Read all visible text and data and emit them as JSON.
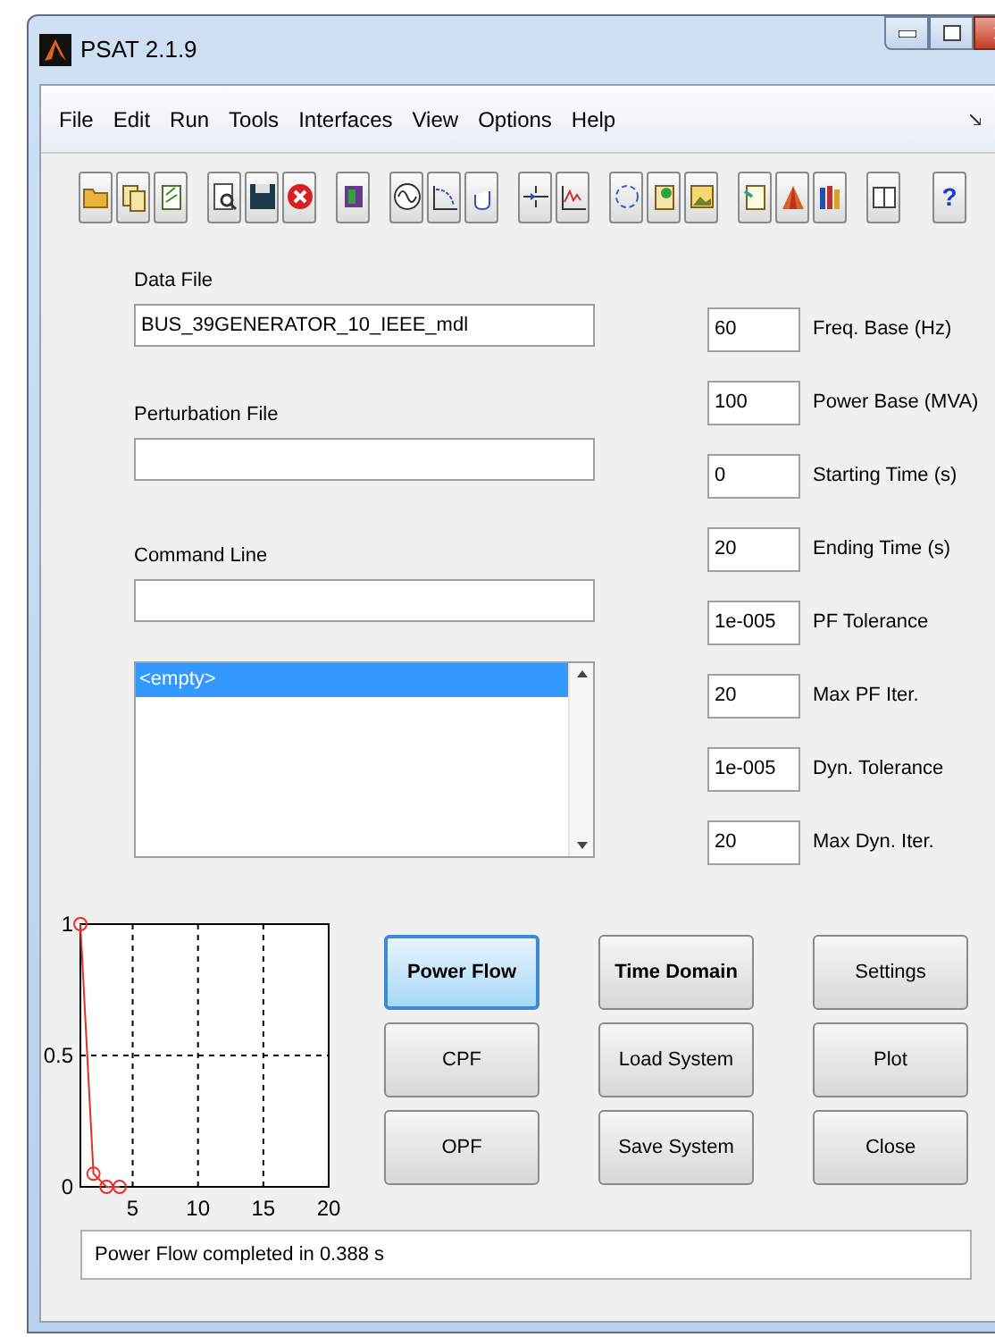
{
  "window": {
    "title": "PSAT 2.1.9"
  },
  "menu": [
    "File",
    "Edit",
    "Run",
    "Tools",
    "Interfaces",
    "View",
    "Options",
    "Help"
  ],
  "toolbar": {
    "help_glyph": "?"
  },
  "files": [
    {
      "label": "Data File",
      "value": "BUS_39GENERATOR_10_IEEE_mdl"
    },
    {
      "label": "Perturbation File"
    },
    {
      "label": "Command Line"
    }
  ],
  "listbox": {
    "items": [
      {
        "text": "<empty>",
        "selected": true
      }
    ]
  },
  "settings": [
    {
      "value": "60",
      "label": "Freq. Base (Hz)"
    },
    {
      "value": "100",
      "label": "Power Base (MVA)"
    },
    {
      "value": "0",
      "label": "Starting Time (s)"
    },
    {
      "value": "20",
      "label": "Ending Time (s)"
    },
    {
      "value": "1e-005",
      "label": "PF Tolerance"
    },
    {
      "value": "20",
      "label": "Max PF Iter."
    },
    {
      "value": "1e-005",
      "label": "Dyn. Tolerance"
    },
    {
      "value": "20",
      "label": "Max Dyn. Iter."
    }
  ],
  "plot": {
    "chart_data": {
      "type": "line",
      "x": [
        1,
        2,
        3,
        4
      ],
      "series": [
        {
          "color": "#e0302a",
          "marker": "o",
          "values": [
            1,
            0.05,
            0,
            0
          ]
        }
      ],
      "grid": true,
      "xlim": [
        1,
        20
      ],
      "ylim": [
        0,
        1
      ],
      "xticks": [
        5,
        10,
        15,
        20
      ],
      "yticks": [
        0,
        0.5,
        1
      ]
    }
  },
  "buttons": [
    {
      "label": "Power Flow",
      "bold": true,
      "focused": true
    },
    {
      "label": "Time Domain",
      "bold": true,
      "focused": false
    },
    {
      "label": "Settings",
      "bold": false,
      "focused": false
    },
    {
      "label": "CPF",
      "bold": false,
      "focused": false
    },
    {
      "label": "Load System",
      "bold": false,
      "focused": false
    },
    {
      "label": "Plot",
      "bold": false,
      "focused": false
    },
    {
      "label": "OPF",
      "bold": false,
      "focused": false
    },
    {
      "label": "Save System",
      "bold": false,
      "focused": false
    },
    {
      "label": "Close",
      "bold": false,
      "focused": false
    }
  ],
  "status_bar": "Power Flow completed in 0.388 s"
}
